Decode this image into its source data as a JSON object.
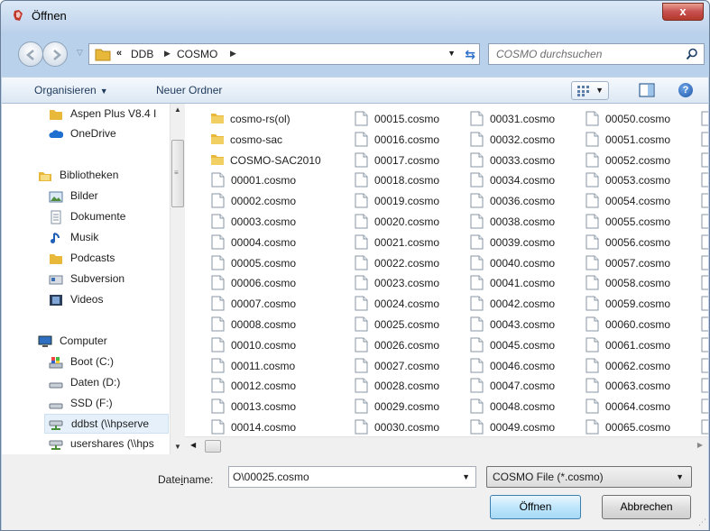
{
  "window": {
    "title": "Öffnen",
    "close_label": "x"
  },
  "address_bar": {
    "overflow": "«",
    "crumbs": [
      "DDB",
      "COSMO"
    ]
  },
  "search": {
    "placeholder": "COSMO durchsuchen"
  },
  "toolbar": {
    "organize_label": "Organisieren",
    "new_folder_label": "Neuer Ordner",
    "help_label": "?"
  },
  "sidebar": {
    "items": [
      {
        "label": "Aspen Plus V8.4 I",
        "icon": "folder-icon"
      },
      {
        "label": "OneDrive",
        "icon": "cloud-icon"
      },
      {
        "label": "Bibliotheken",
        "icon": "library-icon"
      },
      {
        "label": "Bilder",
        "icon": "pictures-icon"
      },
      {
        "label": "Dokumente",
        "icon": "documents-icon"
      },
      {
        "label": "Musik",
        "icon": "music-icon"
      },
      {
        "label": "Podcasts",
        "icon": "folder-icon"
      },
      {
        "label": "Subversion",
        "icon": "subversion-icon"
      },
      {
        "label": "Videos",
        "icon": "videos-icon"
      },
      {
        "label": "Computer",
        "icon": "computer-icon"
      },
      {
        "label": "Boot (C:)",
        "icon": "drive-icon"
      },
      {
        "label": "Daten (D:)",
        "icon": "drive-icon"
      },
      {
        "label": "SSD (F:)",
        "icon": "drive-icon"
      },
      {
        "label": "ddbst (\\\\hpserve",
        "icon": "network-drive-icon"
      },
      {
        "label": "usershares (\\\\hps",
        "icon": "network-drive-icon"
      }
    ]
  },
  "files": {
    "folders": [
      "cosmo-rs(ol)",
      "cosmo-sac",
      "COSMO-SAC2010"
    ],
    "col1": [
      "00001.cosmo",
      "00002.cosmo",
      "00003.cosmo",
      "00004.cosmo",
      "00005.cosmo",
      "00006.cosmo",
      "00007.cosmo",
      "00008.cosmo",
      "00010.cosmo",
      "00011.cosmo",
      "00012.cosmo",
      "00013.cosmo",
      "00014.cosmo"
    ],
    "col2": [
      "00015.cosmo",
      "00016.cosmo",
      "00017.cosmo",
      "00018.cosmo",
      "00019.cosmo",
      "00020.cosmo",
      "00021.cosmo",
      "00022.cosmo",
      "00023.cosmo",
      "00024.cosmo",
      "00025.cosmo",
      "00026.cosmo",
      "00027.cosmo",
      "00028.cosmo",
      "00029.cosmo",
      "00030.cosmo"
    ],
    "col3": [
      "00031.cosmo",
      "00032.cosmo",
      "00033.cosmo",
      "00034.cosmo",
      "00036.cosmo",
      "00038.cosmo",
      "00039.cosmo",
      "00040.cosmo",
      "00041.cosmo",
      "00042.cosmo",
      "00043.cosmo",
      "00045.cosmo",
      "00046.cosmo",
      "00047.cosmo",
      "00048.cosmo",
      "00049.cosmo"
    ],
    "col4": [
      "00050.cosmo",
      "00051.cosmo",
      "00052.cosmo",
      "00053.cosmo",
      "00054.cosmo",
      "00055.cosmo",
      "00056.cosmo",
      "00057.cosmo",
      "00058.cosmo",
      "00059.cosmo",
      "00060.cosmo",
      "00061.cosmo",
      "00062.cosmo",
      "00063.cosmo",
      "00064.cosmo",
      "00065.cosmo"
    ]
  },
  "footer": {
    "filename_label_pre": "Date",
    "filename_label_accel": "i",
    "filename_label_post": "name:",
    "filename_value": "O\\00025.cosmo",
    "filter_value": "COSMO File (*.cosmo)",
    "open_label": "Öffnen",
    "cancel_label": "Abbrechen"
  }
}
